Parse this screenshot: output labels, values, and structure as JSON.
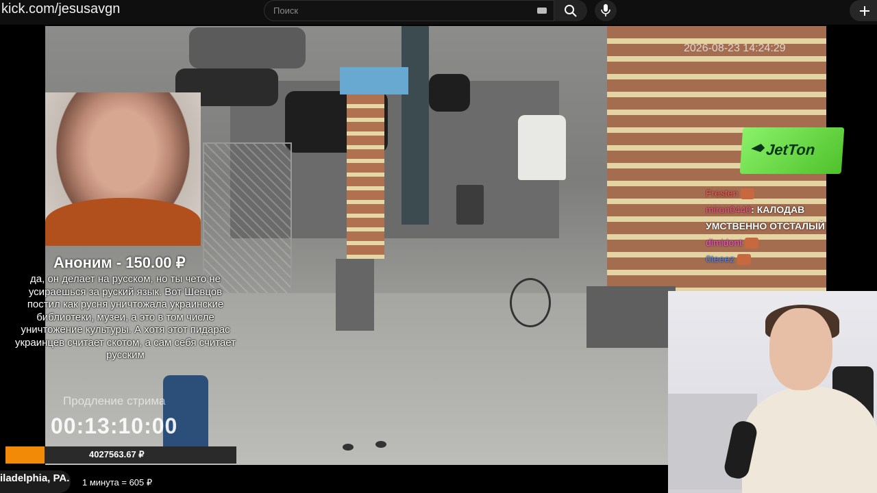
{
  "browser": {
    "url": "kick.com/jesusavgn",
    "search_placeholder": "Поиск",
    "icons": {
      "search": "search-icon",
      "mic": "microphone-icon",
      "add": "plus-icon",
      "keyboard": "keyboard-icon"
    }
  },
  "video": {
    "camera_timestamp": "2026-08-23 14:24:29"
  },
  "donation": {
    "title": "Аноним - 150.00 ₽",
    "message": "да, он делает на русском, но ты чето не усираешься за руский язык. Вот Шевцов постил как русня уничтожала украинские библиотеки, музеи, а это в том числе уничтожение культуры. А хотя этот пидарас украинцев считает скотом, а сам себя считает русским"
  },
  "stream_extension": {
    "label": "Продление стрима",
    "timer": "00:13:10:00",
    "balance": "4027563.67 ₽",
    "progress_fraction": 0.17
  },
  "sponsor": {
    "name": "JetTon",
    "color": "#6ddc44"
  },
  "chat": [
    {
      "user": "Fresten",
      "message": "",
      "color": "#ff5a5a",
      "emote": true
    },
    {
      "user": "miron0440",
      "message": "КАЛОДАВ УМСТВЕННО ОТСТАЛЫЙ",
      "color": "#ff4f8a",
      "emote": false
    },
    {
      "user": "dimidont",
      "message": "",
      "color": "#ff4fd8",
      "emote": true
    },
    {
      "user": "0teeez",
      "message": "",
      "color": "#4f8bff",
      "emote": true
    }
  ],
  "footer": {
    "location": "iladelphia, PA.",
    "rate": "1 минута = 605 ₽"
  }
}
